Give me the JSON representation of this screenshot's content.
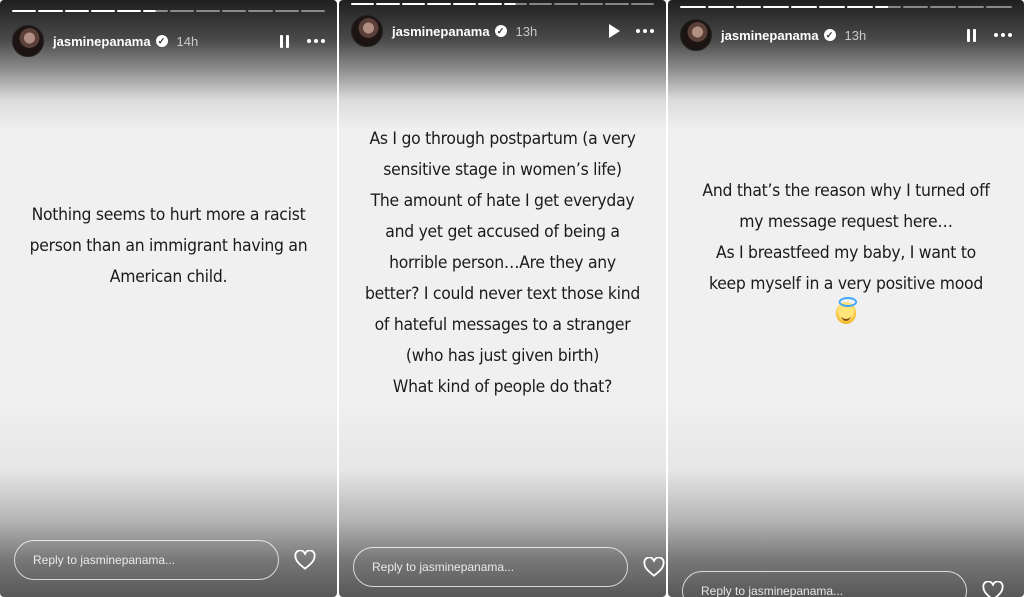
{
  "stories": [
    {
      "username": "jasminepanama",
      "verified_mark": "✓",
      "time": "14h",
      "playback_state": "paused",
      "text_lines": [
        "Nothing seems to hurt more a racist",
        "person than an immigrant having an",
        "American child."
      ],
      "reply_placeholder": "Reply to jasminepanama..."
    },
    {
      "username": "jasminepanama",
      "verified_mark": "✓",
      "time": "13h",
      "playback_state": "playing",
      "text_lines": [
        "As I go through postpartum (a very",
        "sensitive stage in women’s life)",
        "The amount of hate I get everyday",
        "and yet get accused of being a",
        "horrible person…Are they any",
        "better? I could never text those kind",
        "of hateful messages to a stranger",
        "(who has just given birth)",
        "What kind of people do that?"
      ],
      "reply_placeholder": "Reply to jasminepanama..."
    },
    {
      "username": "jasminepanama",
      "verified_mark": "✓",
      "time": "13h",
      "playback_state": "paused",
      "text_lines": [
        "And that’s the reason why I turned off",
        "my message request here…",
        "As I breastfeed my baby, I want to",
        "keep myself in a very positive mood"
      ],
      "emoji": "smiling-face-with-halo",
      "reply_placeholder": "Reply to jasminepanama..."
    }
  ],
  "icons": {
    "pause": "pause-icon",
    "play": "play-icon",
    "more": "more-options-icon",
    "like": "heart-icon",
    "verified": "verified-badge-icon"
  },
  "colors": {
    "text": "#1b1b1b",
    "header_text": "#ffffff",
    "story_background": "#f0f0f0"
  }
}
